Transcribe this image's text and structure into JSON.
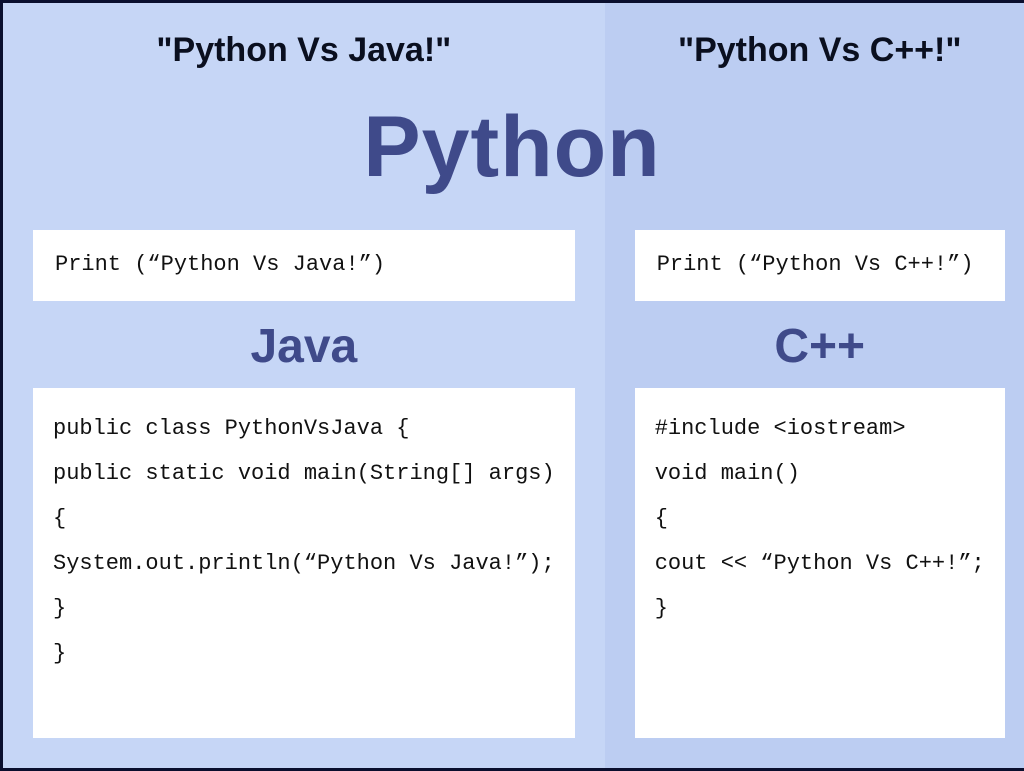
{
  "main_title": "Python",
  "left": {
    "heading": "\"Python Vs Java!\"",
    "python_label": "Python",
    "python_code": [
      "Print (“Python Vs Java!”)"
    ],
    "other_label": "Java",
    "other_code": [
      "public class PythonVsJava {",
      "public static void main(String[] args)",
      "{",
      "System.out.println(“Python Vs Java!”);",
      "}",
      "}"
    ]
  },
  "right": {
    "heading": "\"Python Vs C++!\"",
    "python_label": "Python",
    "python_code": [
      "Print (“Python Vs C++!”)"
    ],
    "other_label": "C++",
    "other_code": [
      "#include <iostream>",
      "void main()",
      "{",
      "cout << “Python Vs C++!”;",
      "}"
    ]
  }
}
